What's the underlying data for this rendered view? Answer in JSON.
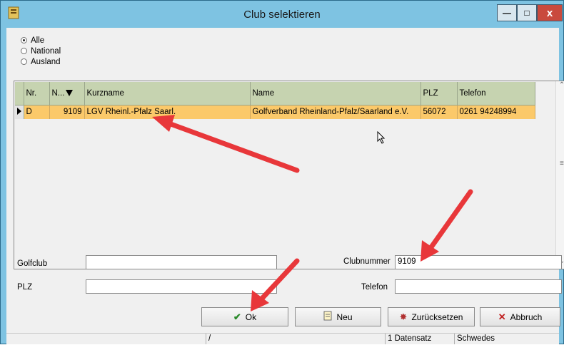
{
  "window": {
    "title": "Club selektieren",
    "minimize_glyph": "—",
    "maximize_glyph": "□",
    "close_glyph": "x"
  },
  "filter": {
    "options": [
      {
        "label": "Alle",
        "selected": true
      },
      {
        "label": "National",
        "selected": false
      },
      {
        "label": "Ausland",
        "selected": false
      }
    ]
  },
  "grid": {
    "columns": [
      "Nr.",
      "N...",
      "Kurzname",
      "Name",
      "PLZ",
      "Telefon"
    ],
    "rows": [
      {
        "nr": "D",
        "nummer": "9109",
        "kurzname": "LGV Rheinl.-Pfalz Saarl.",
        "name": "Golfverband Rheinland-Pfalz/Saarland e.V.",
        "plz": "56072",
        "telefon": "0261 94248994"
      }
    ]
  },
  "form": {
    "golfclub_label": "Golfclub",
    "golfclub_value": "",
    "plz_label": "PLZ",
    "plz_value": "",
    "clubnummer_label": "Clubnummer",
    "clubnummer_value": "9109",
    "telefon_label": "Telefon",
    "telefon_value": ""
  },
  "buttons": {
    "ok": "Ok",
    "neu": "Neu",
    "zuruecksetzen": "Zurücksetzen",
    "abbruch": "Abbruch"
  },
  "status": {
    "cell1": "/",
    "count": "1 Datensatz",
    "user": "Schwedes"
  },
  "colors": {
    "selected_row": "#fbc96a",
    "header": "#c6d3b0",
    "annotation_arrow": "#e8373a"
  },
  "icons": {
    "app": "app-icon",
    "ok": "checkmark-icon",
    "neu": "new-document-icon",
    "zuruecksetzen": "reset-icon",
    "abbruch": "x-icon"
  }
}
